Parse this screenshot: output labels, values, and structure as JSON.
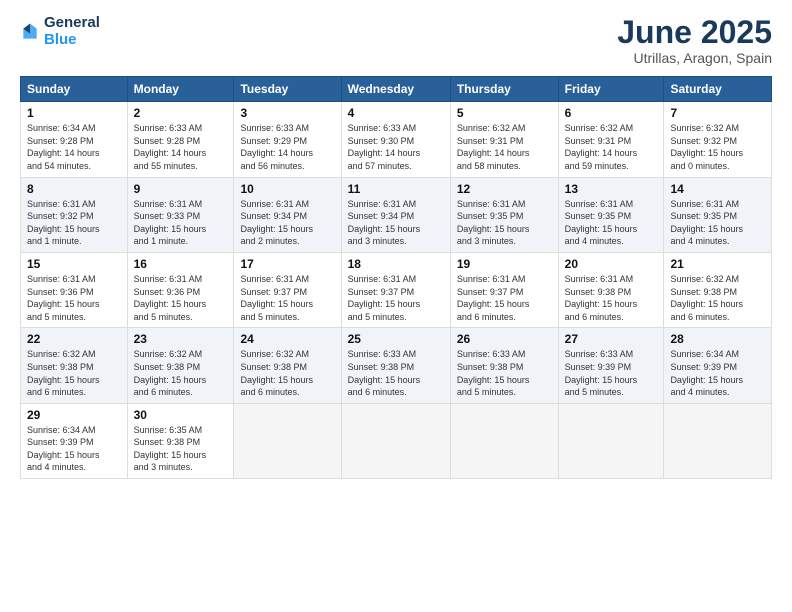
{
  "logo": {
    "line1": "General",
    "line2": "Blue"
  },
  "title": "June 2025",
  "subtitle": "Utrillas, Aragon, Spain",
  "days_of_week": [
    "Sunday",
    "Monday",
    "Tuesday",
    "Wednesday",
    "Thursday",
    "Friday",
    "Saturday"
  ],
  "weeks": [
    [
      {
        "day": "1",
        "info": "Sunrise: 6:34 AM\nSunset: 9:28 PM\nDaylight: 14 hours\nand 54 minutes."
      },
      {
        "day": "2",
        "info": "Sunrise: 6:33 AM\nSunset: 9:28 PM\nDaylight: 14 hours\nand 55 minutes."
      },
      {
        "day": "3",
        "info": "Sunrise: 6:33 AM\nSunset: 9:29 PM\nDaylight: 14 hours\nand 56 minutes."
      },
      {
        "day": "4",
        "info": "Sunrise: 6:33 AM\nSunset: 9:30 PM\nDaylight: 14 hours\nand 57 minutes."
      },
      {
        "day": "5",
        "info": "Sunrise: 6:32 AM\nSunset: 9:31 PM\nDaylight: 14 hours\nand 58 minutes."
      },
      {
        "day": "6",
        "info": "Sunrise: 6:32 AM\nSunset: 9:31 PM\nDaylight: 14 hours\nand 59 minutes."
      },
      {
        "day": "7",
        "info": "Sunrise: 6:32 AM\nSunset: 9:32 PM\nDaylight: 15 hours\nand 0 minutes."
      }
    ],
    [
      {
        "day": "8",
        "info": "Sunrise: 6:31 AM\nSunset: 9:32 PM\nDaylight: 15 hours\nand 1 minute."
      },
      {
        "day": "9",
        "info": "Sunrise: 6:31 AM\nSunset: 9:33 PM\nDaylight: 15 hours\nand 1 minute."
      },
      {
        "day": "10",
        "info": "Sunrise: 6:31 AM\nSunset: 9:34 PM\nDaylight: 15 hours\nand 2 minutes."
      },
      {
        "day": "11",
        "info": "Sunrise: 6:31 AM\nSunset: 9:34 PM\nDaylight: 15 hours\nand 3 minutes."
      },
      {
        "day": "12",
        "info": "Sunrise: 6:31 AM\nSunset: 9:35 PM\nDaylight: 15 hours\nand 3 minutes."
      },
      {
        "day": "13",
        "info": "Sunrise: 6:31 AM\nSunset: 9:35 PM\nDaylight: 15 hours\nand 4 minutes."
      },
      {
        "day": "14",
        "info": "Sunrise: 6:31 AM\nSunset: 9:35 PM\nDaylight: 15 hours\nand 4 minutes."
      }
    ],
    [
      {
        "day": "15",
        "info": "Sunrise: 6:31 AM\nSunset: 9:36 PM\nDaylight: 15 hours\nand 5 minutes."
      },
      {
        "day": "16",
        "info": "Sunrise: 6:31 AM\nSunset: 9:36 PM\nDaylight: 15 hours\nand 5 minutes."
      },
      {
        "day": "17",
        "info": "Sunrise: 6:31 AM\nSunset: 9:37 PM\nDaylight: 15 hours\nand 5 minutes."
      },
      {
        "day": "18",
        "info": "Sunrise: 6:31 AM\nSunset: 9:37 PM\nDaylight: 15 hours\nand 5 minutes."
      },
      {
        "day": "19",
        "info": "Sunrise: 6:31 AM\nSunset: 9:37 PM\nDaylight: 15 hours\nand 6 minutes."
      },
      {
        "day": "20",
        "info": "Sunrise: 6:31 AM\nSunset: 9:38 PM\nDaylight: 15 hours\nand 6 minutes."
      },
      {
        "day": "21",
        "info": "Sunrise: 6:32 AM\nSunset: 9:38 PM\nDaylight: 15 hours\nand 6 minutes."
      }
    ],
    [
      {
        "day": "22",
        "info": "Sunrise: 6:32 AM\nSunset: 9:38 PM\nDaylight: 15 hours\nand 6 minutes."
      },
      {
        "day": "23",
        "info": "Sunrise: 6:32 AM\nSunset: 9:38 PM\nDaylight: 15 hours\nand 6 minutes."
      },
      {
        "day": "24",
        "info": "Sunrise: 6:32 AM\nSunset: 9:38 PM\nDaylight: 15 hours\nand 6 minutes."
      },
      {
        "day": "25",
        "info": "Sunrise: 6:33 AM\nSunset: 9:38 PM\nDaylight: 15 hours\nand 6 minutes."
      },
      {
        "day": "26",
        "info": "Sunrise: 6:33 AM\nSunset: 9:38 PM\nDaylight: 15 hours\nand 5 minutes."
      },
      {
        "day": "27",
        "info": "Sunrise: 6:33 AM\nSunset: 9:39 PM\nDaylight: 15 hours\nand 5 minutes."
      },
      {
        "day": "28",
        "info": "Sunrise: 6:34 AM\nSunset: 9:39 PM\nDaylight: 15 hours\nand 4 minutes."
      }
    ],
    [
      {
        "day": "29",
        "info": "Sunrise: 6:34 AM\nSunset: 9:39 PM\nDaylight: 15 hours\nand 4 minutes."
      },
      {
        "day": "30",
        "info": "Sunrise: 6:35 AM\nSunset: 9:38 PM\nDaylight: 15 hours\nand 3 minutes."
      },
      {
        "day": "",
        "info": ""
      },
      {
        "day": "",
        "info": ""
      },
      {
        "day": "",
        "info": ""
      },
      {
        "day": "",
        "info": ""
      },
      {
        "day": "",
        "info": ""
      }
    ]
  ]
}
